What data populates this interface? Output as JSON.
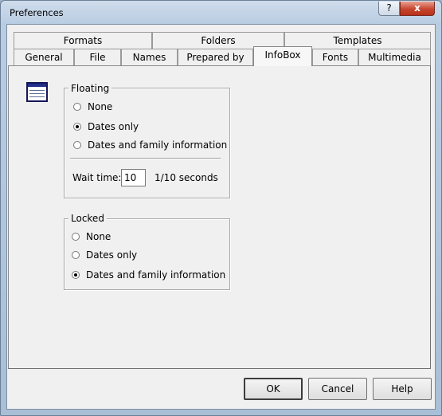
{
  "window": {
    "title": "Preferences",
    "help_glyph": "?",
    "close_glyph": "x"
  },
  "tabs": {
    "row_back": [
      {
        "label": "Formats"
      },
      {
        "label": "Folders"
      },
      {
        "label": "Templates"
      }
    ],
    "row_front": [
      {
        "label": "General"
      },
      {
        "label": "File"
      },
      {
        "label": "Names"
      },
      {
        "label": "Prepared by"
      },
      {
        "label": "InfoBox",
        "active": true
      },
      {
        "label": "Fonts"
      },
      {
        "label": "Multimedia"
      }
    ]
  },
  "infobox_icon": "infobox-window-icon",
  "floating": {
    "label": "Floating",
    "options": [
      {
        "label": "None",
        "checked": false
      },
      {
        "label": "Dates only",
        "checked": true
      },
      {
        "label": "Dates and family information",
        "checked": false
      }
    ],
    "wait_label": "Wait time:",
    "wait_value": "10",
    "wait_units": "1/10 seconds"
  },
  "locked": {
    "label": "Locked",
    "options": [
      {
        "label": "None",
        "checked": false
      },
      {
        "label": "Dates only",
        "checked": false
      },
      {
        "label": "Dates and family information",
        "checked": true
      }
    ]
  },
  "buttons": {
    "ok": "OK",
    "cancel": "Cancel",
    "help": "Help"
  }
}
